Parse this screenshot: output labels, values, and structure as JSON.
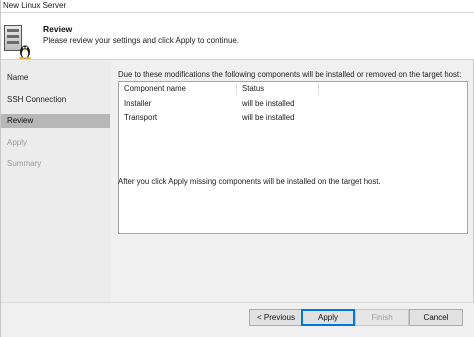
{
  "window": {
    "title": "New Linux Server"
  },
  "header": {
    "title": "Review",
    "description": "Please review your settings and click Apply to continue."
  },
  "sidebar": {
    "items": [
      {
        "label": "Name",
        "state": "normal"
      },
      {
        "label": "SSH Connection",
        "state": "normal"
      },
      {
        "label": "Review",
        "state": "active"
      },
      {
        "label": "Apply",
        "state": "disabled"
      },
      {
        "label": "Summary",
        "state": "disabled"
      }
    ]
  },
  "main": {
    "info_text": "Due to these modifications the following components will be installed or removed on the target host:",
    "table": {
      "columns": [
        "Component name",
        "Status"
      ],
      "rows": [
        {
          "component": "Installer",
          "status": "will be installed"
        },
        {
          "component": "Transport",
          "status": "will be installed"
        }
      ]
    },
    "after_text": "After you click Apply missing components will be installed on the target host."
  },
  "footer": {
    "previous_label": "< Previous",
    "apply_label": "Apply",
    "finish_label": "Finish",
    "cancel_label": "Cancel"
  },
  "colors": {
    "accent": "#0078d7",
    "selected_nav": "#b7b7b7"
  }
}
